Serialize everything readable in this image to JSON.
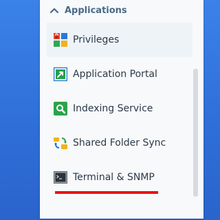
{
  "sidebar": {
    "section_title": "Applications",
    "items": [
      {
        "label": "Privileges",
        "icon": "privileges-icon",
        "active": true
      },
      {
        "label": "Application Portal",
        "icon": "application-portal-icon",
        "active": false
      },
      {
        "label": "Indexing Service",
        "icon": "indexing-service-icon",
        "active": false
      },
      {
        "label": "Shared Folder Sync",
        "icon": "shared-folder-sync-icon",
        "active": false
      },
      {
        "label": "Terminal & SNMP",
        "icon": "terminal-icon",
        "active": false
      }
    ]
  },
  "colors": {
    "desktop_background": "#2f6fd8",
    "panel_background": "#f7f9fb",
    "section_title": "#4a6a88",
    "item_text": "#2b3a48",
    "highlight_mark": "#ee1111"
  }
}
